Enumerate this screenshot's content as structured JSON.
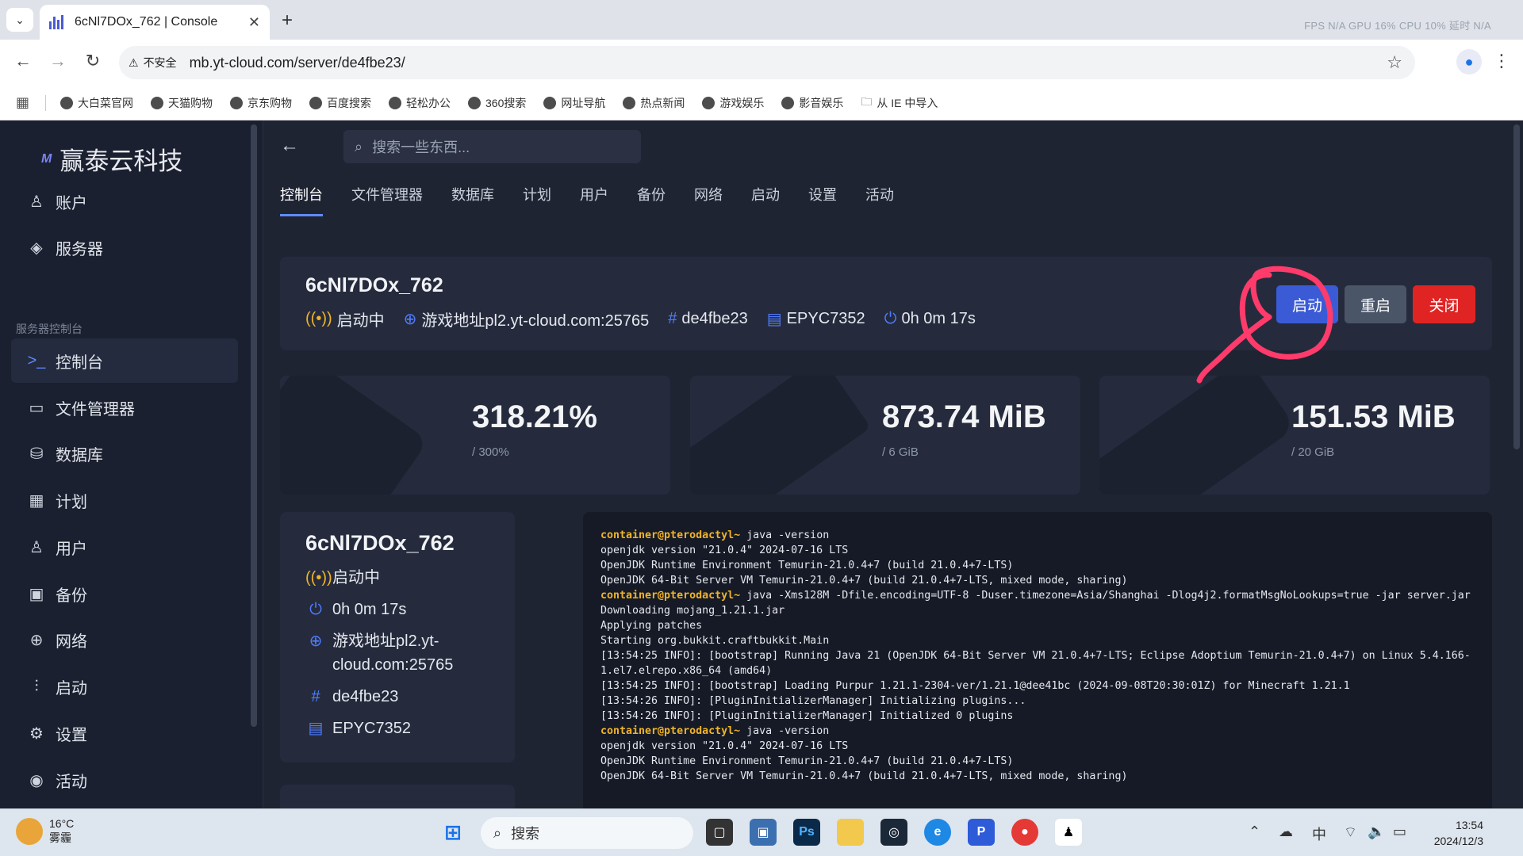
{
  "browser": {
    "tab_title": "6cNl7DOx_762 | Console",
    "url": "mb.yt-cloud.com/server/de4fbe23/",
    "insecure_label": "不安全",
    "perf_overlay": "FPS N/A GPU 16% CPU 10% 延时 N/A",
    "bookmarks": [
      "大白菜官网",
      "天猫购物",
      "京东购物",
      "百度搜索",
      "轻松办公",
      "360搜索",
      "网址导航",
      "热点新闻",
      "游戏娱乐",
      "影音娱乐",
      "从 IE 中导入"
    ]
  },
  "sidebar": {
    "brand": "赢泰云科技",
    "logo_text": "M",
    "items_top": [
      {
        "label": "账户",
        "icon": "user-icon"
      },
      {
        "label": "服务器",
        "icon": "layers-icon"
      }
    ],
    "section_label": "服务器控制台",
    "items": [
      {
        "label": "控制台",
        "icon": "terminal-icon",
        "active": true
      },
      {
        "label": "文件管理器",
        "icon": "folder-icon"
      },
      {
        "label": "数据库",
        "icon": "database-icon"
      },
      {
        "label": "计划",
        "icon": "calendar-icon"
      },
      {
        "label": "用户",
        "icon": "users-icon"
      },
      {
        "label": "备份",
        "icon": "save-icon"
      },
      {
        "label": "网络",
        "icon": "globe-icon"
      },
      {
        "label": "启动",
        "icon": "sliders-icon"
      },
      {
        "label": "设置",
        "icon": "gear-icon"
      },
      {
        "label": "活动",
        "icon": "eye-icon"
      }
    ]
  },
  "main": {
    "search_placeholder": "搜索一些东西...",
    "tabs": [
      "控制台",
      "文件管理器",
      "数据库",
      "计划",
      "用户",
      "备份",
      "网络",
      "启动",
      "设置",
      "活动"
    ],
    "server": {
      "name": "6cNl7DOx_762",
      "status": "启动中",
      "address": "游戏地址pl2.yt-cloud.com:25765",
      "address_line1": "游戏地址pl2.yt-",
      "address_line2": "cloud.com:25765",
      "id": "de4fbe23",
      "node": "EPYC7352",
      "uptime": "0h 0m 17s"
    },
    "buttons": {
      "start": "启动",
      "restart": "重启",
      "stop": "关闭"
    },
    "stats": [
      {
        "value": "318.21%",
        "limit": "/ 300%"
      },
      {
        "value": "873.74 MiB",
        "limit": "/ 6 GiB"
      },
      {
        "value": "151.53 MiB",
        "limit": "/ 20 GiB"
      }
    ],
    "console_lines": [
      {
        "prompt": "container@pterodactyl~",
        "text": " java -version"
      },
      {
        "prompt": "",
        "text": "openjdk version \"21.0.4\" 2024-07-16 LTS"
      },
      {
        "prompt": "",
        "text": "OpenJDK Runtime Environment Temurin-21.0.4+7 (build 21.0.4+7-LTS)"
      },
      {
        "prompt": "",
        "text": "OpenJDK 64-Bit Server VM Temurin-21.0.4+7 (build 21.0.4+7-LTS, mixed mode, sharing)"
      },
      {
        "prompt": "container@pterodactyl~",
        "text": " java -Xms128M -Dfile.encoding=UTF-8 -Duser.timezone=Asia/Shanghai -Dlog4j2.formatMsgNoLookups=true -jar server.jar"
      },
      {
        "prompt": "",
        "text": "Downloading mojang_1.21.1.jar"
      },
      {
        "prompt": "",
        "text": "Applying patches"
      },
      {
        "prompt": "",
        "text": "Starting org.bukkit.craftbukkit.Main"
      },
      {
        "prompt": "",
        "text": "[13:54:25 INFO]: [bootstrap] Running Java 21 (OpenJDK 64-Bit Server VM 21.0.4+7-LTS; Eclipse Adoptium Temurin-21.0.4+7) on Linux 5.4.166-1.el7.elrepo.x86_64 (amd64)"
      },
      {
        "prompt": "",
        "text": "[13:54:25 INFO]: [bootstrap] Loading Purpur 1.21.1-2304-ver/1.21.1@dee41bc (2024-09-08T20:30:01Z) for Minecraft 1.21.1"
      },
      {
        "prompt": "",
        "text": "[13:54:26 INFO]: [PluginInitializerManager] Initializing plugins..."
      },
      {
        "prompt": "",
        "text": "[13:54:26 INFO]: [PluginInitializerManager] Initialized 0 plugins"
      },
      {
        "prompt": "container@pterodactyl~",
        "text": " java -version"
      },
      {
        "prompt": "",
        "text": "openjdk version \"21.0.4\" 2024-07-16 LTS"
      },
      {
        "prompt": "",
        "text": "OpenJDK Runtime Environment Temurin-21.0.4+7 (build 21.0.4+7-LTS)"
      },
      {
        "prompt": "",
        "text": "OpenJDK 64-Bit Server VM Temurin-21.0.4+7 (build 21.0.4+7-LTS, mixed mode, sharing)"
      }
    ]
  },
  "taskbar": {
    "temp": "16°C",
    "weather": "雾霾",
    "search": "搜索",
    "ime": "中",
    "time": "13:54",
    "date": "2024/12/3"
  },
  "colors": {
    "accent": "#5f8bff",
    "start_btn": "#3b5bd6",
    "restart_btn": "#4a5568",
    "stop_btn": "#e02424",
    "status_yellow": "#f0b429",
    "annotation": "#ff3b6b"
  }
}
